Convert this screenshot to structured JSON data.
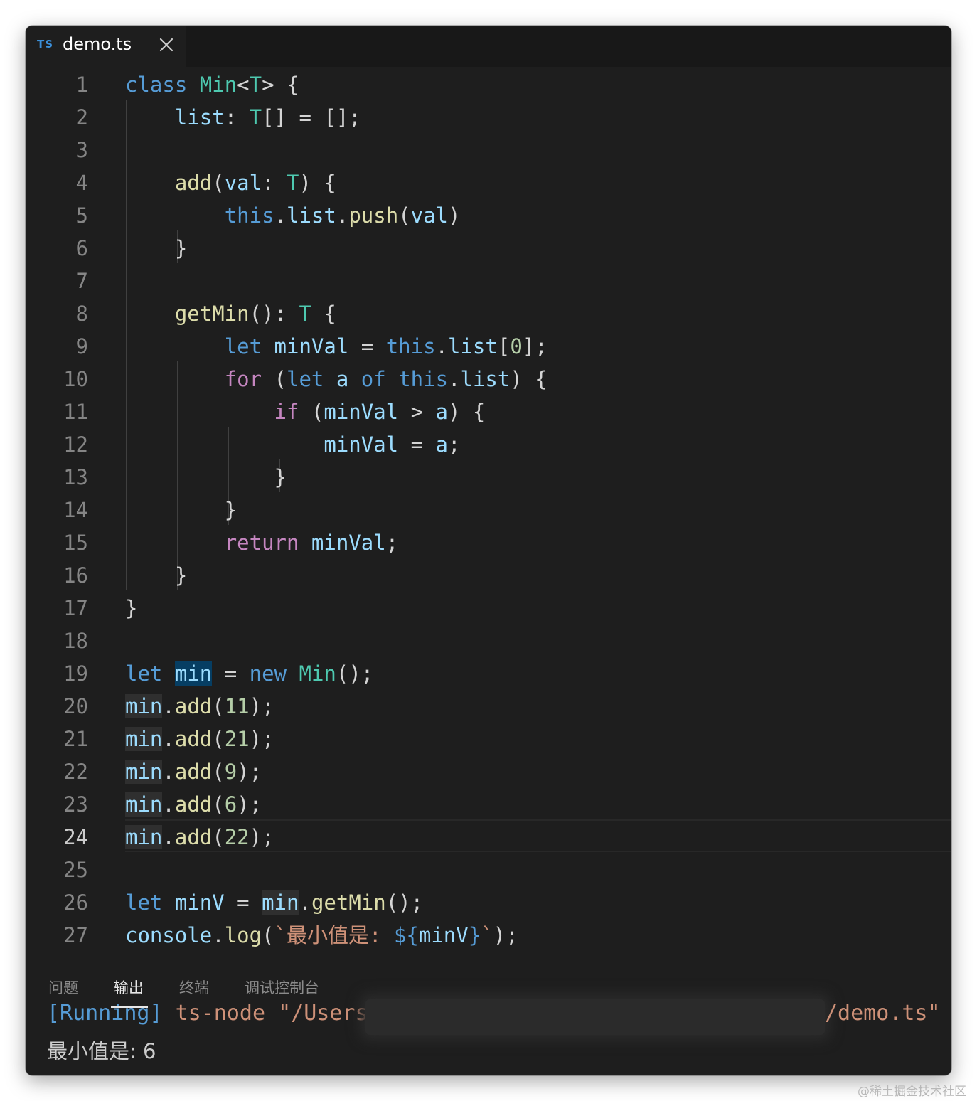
{
  "tab": {
    "icon_text": "TS",
    "title": "demo.ts"
  },
  "editor": {
    "line_numbers": [
      "1",
      "2",
      "3",
      "4",
      "5",
      "6",
      "7",
      "8",
      "9",
      "10",
      "11",
      "12",
      "13",
      "14",
      "15",
      "16",
      "17",
      "18",
      "19",
      "20",
      "21",
      "22",
      "23",
      "24",
      "25",
      "26",
      "27"
    ],
    "active_line": "24",
    "lines": [
      [
        [
          "kw",
          "class"
        ],
        [
          "",
          ""
        ],
        [
          "",
          ""
        ]
      ],
      [],
      [],
      [],
      [],
      [],
      [],
      [],
      [],
      [],
      [],
      [],
      [],
      [],
      [],
      [],
      [],
      [],
      [],
      [],
      [],
      [],
      [],
      [],
      [],
      [],
      []
    ],
    "code": [
      "class Min<T> {",
      "    list: T[] = [];",
      "",
      "    add(val: T) {",
      "        this.list.push(val)",
      "    }",
      "",
      "    getMin(): T {",
      "        let minVal = this.list[0];",
      "        for (let a of this.list) {",
      "            if (minVal > a) {",
      "                minVal = a;",
      "            }",
      "        }",
      "        return minVal;",
      "    }",
      "}",
      "",
      "let min = new Min();",
      "min.add(11);",
      "min.add(21);",
      "min.add(9);",
      "min.add(6);",
      "min.add(22);",
      "",
      "let minV = min.getMin();",
      "console.log(`最小值是: ${minV}`);"
    ],
    "tokens": {
      "class": "class",
      "Min": "Min",
      "T": "T",
      "list": "list",
      "add": "add",
      "val": "val",
      "this": "this",
      "push": "push",
      "getMin": "getMin",
      "let": "let",
      "minVal": "minVal",
      "zero": "0",
      "for": "for",
      "a": "a",
      "of": "of",
      "if": "if",
      "return": "return",
      "min": "min",
      "new": "new",
      "n11": "11",
      "n21": "21",
      "n9": "9",
      "n6": "6",
      "n22": "22",
      "minV": "minV",
      "console": "console",
      "log": "log",
      "tpl_text": "最小值是: ",
      "tpl_open": "${",
      "tpl_close": "}"
    }
  },
  "panel": {
    "tabs": [
      "问题",
      "输出",
      "终端",
      "调试控制台"
    ],
    "active_tab": "输出",
    "output": {
      "running_tag": "[Running]",
      "command_start": "ts-node \"/Users",
      "command_end": "/demo.ts\"",
      "result": "最小值是: 6"
    }
  },
  "watermark": "@稀土掘金技术社区"
}
